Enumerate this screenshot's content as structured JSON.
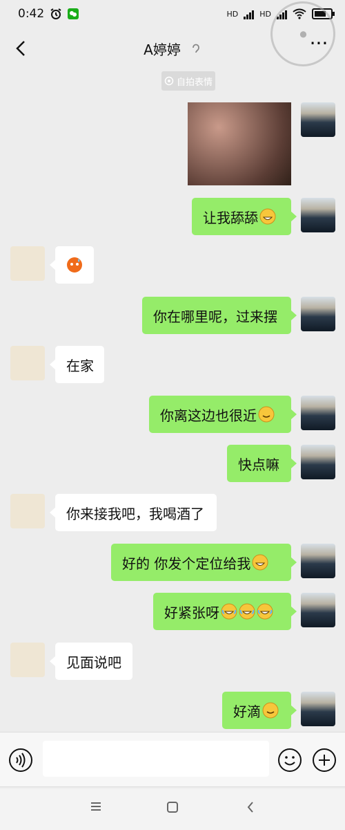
{
  "status": {
    "time": "0:42",
    "hd1": "HD",
    "hd2": "HD"
  },
  "header": {
    "title": "A婷婷",
    "back_icon": "back-chevron-icon",
    "more_icon": "more-icon"
  },
  "timestamp_chip": {
    "label": "自拍表情"
  },
  "messages": [
    {
      "from": "me",
      "type": "image"
    },
    {
      "from": "me",
      "text": "让我舔舔",
      "emoji": [
        "grin"
      ]
    },
    {
      "from": "them",
      "type": "emoji",
      "emoji": [
        "shy-sweat"
      ]
    },
    {
      "from": "me",
      "text": "你在哪里呢，过来摆"
    },
    {
      "from": "them",
      "text": "在家"
    },
    {
      "from": "me",
      "text": "你离这边也很近",
      "emoji": [
        "smile"
      ]
    },
    {
      "from": "me",
      "text": "快点嘛"
    },
    {
      "from": "them",
      "text": "你来接我吧，我喝酒了"
    },
    {
      "from": "me",
      "text": "好的  你发个定位给我",
      "emoji": [
        "grin"
      ]
    },
    {
      "from": "me",
      "text": "好紧张呀",
      "emoji": [
        "tears-of-joy",
        "tears-of-joy",
        "tears-of-joy"
      ]
    },
    {
      "from": "them",
      "text": "见面说吧"
    },
    {
      "from": "me",
      "text": "好滴",
      "emoji": [
        "smile"
      ]
    }
  ],
  "input": {
    "voice_icon": "voice-icon",
    "emoji_icon": "emoji-icon",
    "plus_icon": "plus-icon"
  },
  "nav": {
    "menu_icon": "menu-icon",
    "home_icon": "home-icon",
    "back_icon": "back-icon"
  },
  "colors": {
    "accent": "#95ec69",
    "background": "#ededed"
  }
}
